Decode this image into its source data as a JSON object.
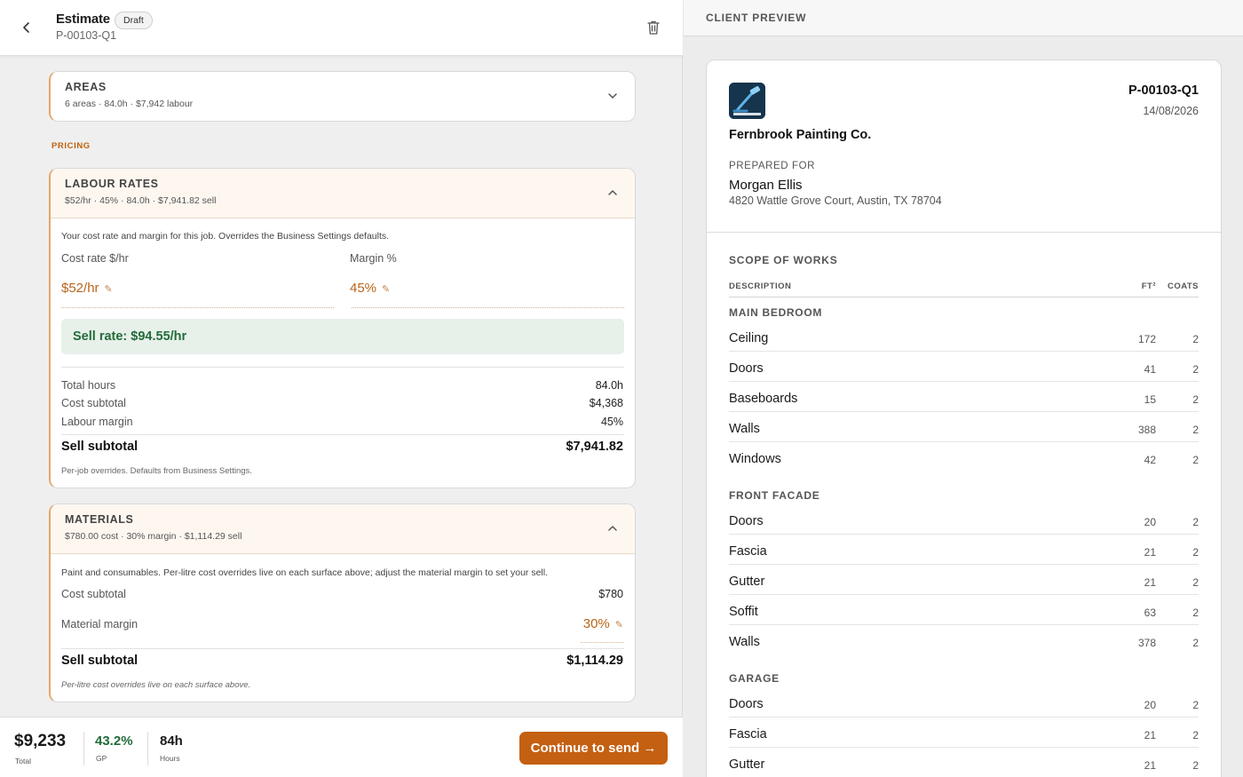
{
  "header": {
    "title": "Estimate",
    "status_badge": "Draft",
    "quote_id": "P-00103-Q1"
  },
  "areas": {
    "title": "AREAS",
    "summary": "6 areas · 84.0h · $7,942 labour"
  },
  "pricing_label": "PRICING",
  "labour": {
    "title": "LABOUR RATES",
    "summary": "$52/hr · 45% · 84.0h · $7,941.82 sell",
    "description": "Your cost rate and margin for this job. Overrides the Business Settings defaults.",
    "cost_rate_label": "Cost rate $/hr",
    "cost_rate_value": "$52/hr",
    "margin_label": "Margin %",
    "margin_value": "45%",
    "sell_rate": "Sell rate: $94.55/hr",
    "rows": [
      {
        "label": "Total hours",
        "value": "84.0h"
      },
      {
        "label": "Cost subtotal",
        "value": "$4,368"
      },
      {
        "label": "Labour margin",
        "value": "45%"
      }
    ],
    "sell_subtotal_label": "Sell subtotal",
    "sell_subtotal_value": "$7,941.82",
    "note": "Per-job overrides. Defaults from Business Settings."
  },
  "materials": {
    "title": "MATERIALS",
    "summary": "$780.00 cost · 30% margin · $1,114.29 sell",
    "description": "Paint and consumables. Per-litre cost overrides live on each surface above; adjust the material margin to set your sell.",
    "cost_subtotal_label": "Cost subtotal",
    "cost_subtotal_value": "$780",
    "margin_label": "Material margin",
    "margin_value": "30%",
    "sell_subtotal_label": "Sell subtotal",
    "sell_subtotal_value": "$1,114.29",
    "note": "Per-litre cost overrides live on each surface above."
  },
  "footer": {
    "total_value": "$9,233",
    "total_label": "Total",
    "gp_value": "43.2%",
    "gp_label": "GP",
    "hours_value": "84h",
    "hours_label": "Hours",
    "continue_label": "Continue to send →"
  },
  "preview": {
    "label": "CLIENT PREVIEW",
    "company": "Fernbrook Painting Co.",
    "doc_id": "P-00103-Q1",
    "date": "14/08/2026",
    "prepared_for_label": "PREPARED FOR",
    "client_name": "Morgan Ellis",
    "client_address": "4820 Wattle Grove Court, Austin, TX 78704",
    "scope_title": "SCOPE OF WORKS",
    "col_description": "DESCRIPTION",
    "col_ft": "FT²",
    "col_coats": "COATS",
    "groups": [
      {
        "name": "MAIN BEDROOM",
        "items": [
          {
            "name": "Ceiling",
            "ft": "172",
            "coats": "2"
          },
          {
            "name": "Doors",
            "ft": "41",
            "coats": "2"
          },
          {
            "name": "Baseboards",
            "ft": "15",
            "coats": "2"
          },
          {
            "name": "Walls",
            "ft": "388",
            "coats": "2"
          },
          {
            "name": "Windows",
            "ft": "42",
            "coats": "2"
          }
        ]
      },
      {
        "name": "FRONT FACADE",
        "items": [
          {
            "name": "Doors",
            "ft": "20",
            "coats": "2"
          },
          {
            "name": "Fascia",
            "ft": "21",
            "coats": "2"
          },
          {
            "name": "Gutter",
            "ft": "21",
            "coats": "2"
          },
          {
            "name": "Soffit",
            "ft": "63",
            "coats": "2"
          },
          {
            "name": "Walls",
            "ft": "378",
            "coats": "2"
          }
        ]
      },
      {
        "name": "GARAGE",
        "items": [
          {
            "name": "Doors",
            "ft": "20",
            "coats": "2"
          },
          {
            "name": "Fascia",
            "ft": "21",
            "coats": "2"
          },
          {
            "name": "Gutter",
            "ft": "21",
            "coats": "2"
          }
        ]
      }
    ]
  },
  "colors": {
    "accent": "#c46012",
    "accent_text": "#b8651c",
    "sell_rate_bg": "#e8f0ea",
    "sell_rate_text": "#236b3a",
    "gp_green": "#236b3a",
    "logo_bg": "#16344c"
  },
  "icons": [
    "back-arrow-icon",
    "trash-icon",
    "chevron-down-icon",
    "chevron-up-icon",
    "pencil-icon",
    "company-logo"
  ]
}
